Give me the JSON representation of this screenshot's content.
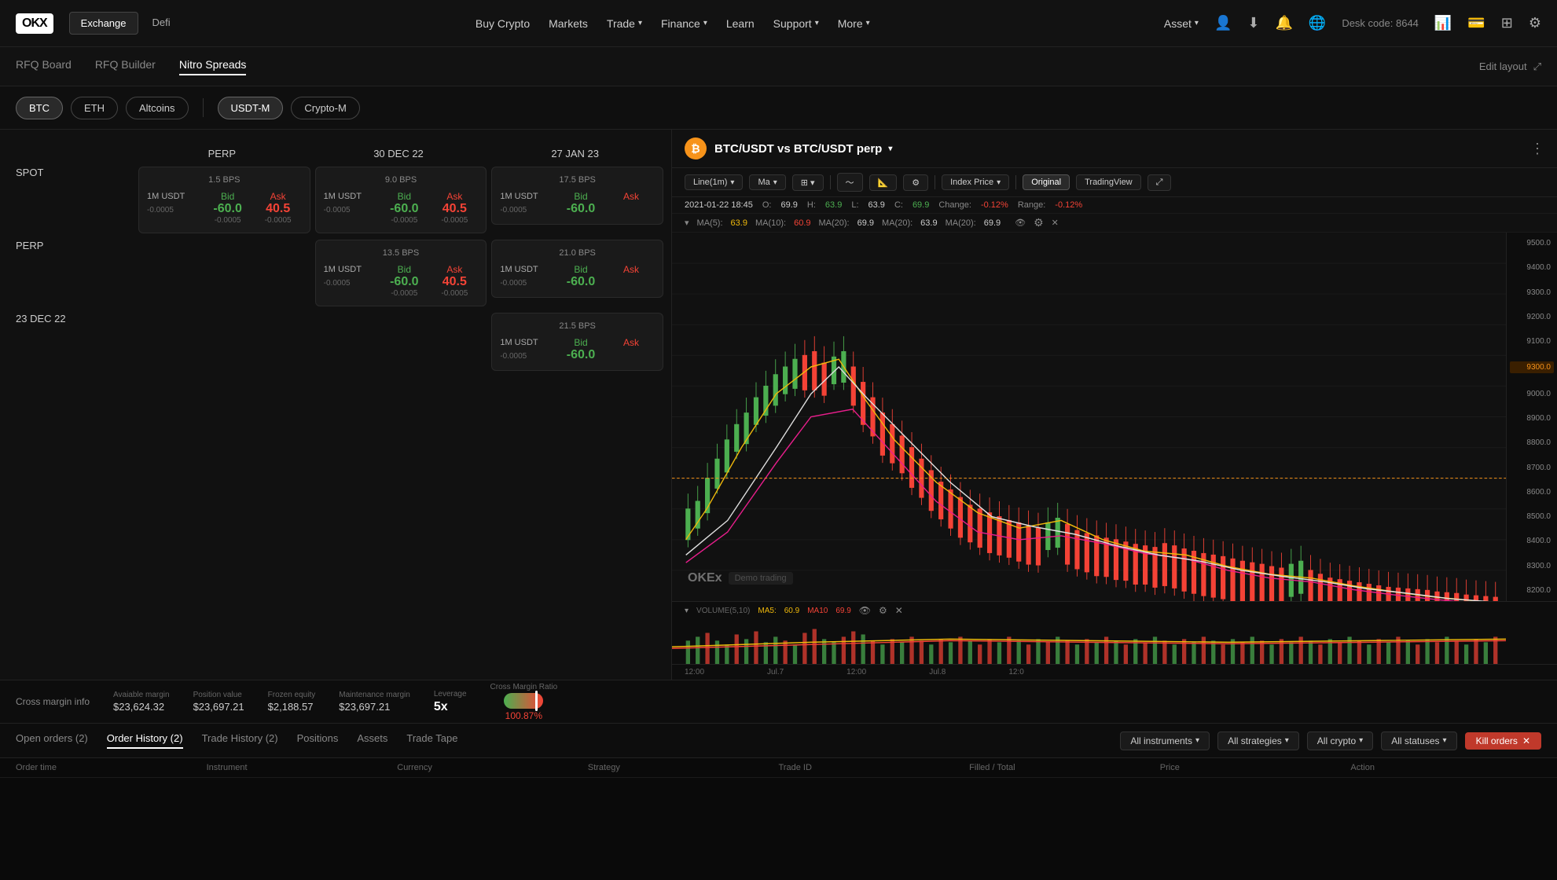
{
  "nav": {
    "logo": "OKX",
    "tabs": [
      {
        "id": "exchange",
        "label": "Exchange",
        "active": true
      },
      {
        "id": "defi",
        "label": "Defi",
        "active": false
      }
    ],
    "links": [
      {
        "id": "buy-crypto",
        "label": "Buy Crypto"
      },
      {
        "id": "markets",
        "label": "Markets"
      },
      {
        "id": "trade",
        "label": "Trade",
        "hasDropdown": true
      },
      {
        "id": "finance",
        "label": "Finance",
        "hasDropdown": true
      },
      {
        "id": "learn",
        "label": "Learn"
      },
      {
        "id": "support",
        "label": "Support",
        "hasDropdown": true
      },
      {
        "id": "more",
        "label": "More",
        "hasDropdown": true
      }
    ],
    "asset_label": "Asset",
    "desk_code_label": "Desk code:",
    "desk_code_value": "8644"
  },
  "sub_nav": {
    "items": [
      {
        "id": "rfq-board",
        "label": "RFQ Board",
        "active": false
      },
      {
        "id": "rfq-builder",
        "label": "RFQ Builder",
        "active": false
      },
      {
        "id": "nitro-spreads",
        "label": "Nitro Spreads",
        "active": true
      }
    ],
    "edit_layout": "Edit layout"
  },
  "filters": {
    "left": [
      {
        "id": "btc",
        "label": "BTC",
        "active": true
      },
      {
        "id": "eth",
        "label": "ETH",
        "active": false
      },
      {
        "id": "altcoins",
        "label": "Altcoins",
        "active": false
      }
    ],
    "right": [
      {
        "id": "usdt-m",
        "label": "USDT-M",
        "active": true
      },
      {
        "id": "crypto-m",
        "label": "Crypto-M",
        "active": false
      }
    ]
  },
  "grid": {
    "col_headers": [
      "PERP",
      "30 DEC 22",
      "27 JAN 23"
    ],
    "row_labels": [
      "SPOT",
      "PERP",
      "23 DEC 22"
    ],
    "cells": {
      "spot_perp": {
        "bps": "1.5 BPS",
        "unit": "1M USDT",
        "bid_label": "Bid",
        "ask_label": "Ask",
        "bid_val": "-60.0",
        "ask_val": "40.5",
        "bid_sub": "-0.0005",
        "ask_sub": "-0.0005"
      },
      "spot_dec30": {
        "bps": "9.0 BPS",
        "unit": "1M USDT",
        "bid_label": "Bid",
        "ask_label": "Ask",
        "bid_val": "-60.0",
        "ask_val": "40.5",
        "bid_sub": "-0.0005",
        "ask_sub": "-0.0005"
      },
      "spot_jan27": {
        "bps": "17.5 BPS",
        "unit": "1M USDT",
        "bid_label": "Bid",
        "ask_label": "Ask",
        "bid_val": "-60.0",
        "bid_sub": "-0.0005"
      },
      "perp_dec30": {
        "bps": "13.5 BPS",
        "unit": "1M USDT",
        "bid_label": "Bid",
        "ask_label": "Ask",
        "bid_val": "-60.0",
        "ask_val": "40.5",
        "bid_sub": "-0.0005",
        "ask_sub": "-0.0005"
      },
      "perp_jan27": {
        "bps": "21.0 BPS",
        "unit": "1M USDT",
        "bid_label": "Bid",
        "ask_label": "Ask",
        "bid_val": "-60.0",
        "bid_sub": "-0.0005"
      },
      "dec23_jan27": {
        "bps": "21.5 BPS",
        "unit": "1M USDT",
        "bid_label": "Bid",
        "ask_label": "Ask",
        "bid_val": "-60.0",
        "bid_sub": "-0.0005"
      }
    }
  },
  "chart": {
    "pair": "BTC/USDT vs BTC/USDT perp",
    "btc_icon": "₿",
    "timeframe": "Line(1m)",
    "indicator": "Ma",
    "original_label": "Original",
    "tradingview_label": "TradingView",
    "index_price": "Index Price",
    "info": {
      "date": "2021-01-22 18:45",
      "open_label": "O:",
      "open_val": "69.9",
      "high_label": "H:",
      "high_val": "63.9",
      "high_color": "green",
      "low_label": "L:",
      "low_val": "63.9",
      "close_label": "C:",
      "close_val": "69.9",
      "close_color": "green",
      "change_label": "Change:",
      "change_val": "-0.12%",
      "change_color": "red",
      "range_label": "Range:",
      "range_val": "-0.12%",
      "range_color": "red"
    },
    "ma": {
      "ma5_label": "MA(5):",
      "ma5_val": "63.9",
      "ma10_label": "MA(10):",
      "ma10_val": "60.9",
      "ma10_color": "red",
      "ma20a_label": "MA(20):",
      "ma20a_val": "69.9",
      "ma20b_label": "MA(20):",
      "ma20b_val": "63.9",
      "ma20c_label": "MA(20):",
      "ma20c_val": "69.9"
    },
    "prices": [
      9500,
      9400,
      9300,
      9200,
      9100,
      9000,
      8900,
      8800,
      8700,
      8600,
      8500,
      8400,
      8300,
      8200
    ],
    "current_price": "9300.0",
    "time_labels": [
      "12:00",
      "Jul.7",
      "12:00",
      "Jul.8",
      "12:0"
    ],
    "volume": {
      "label": "VOLUME(5,10)",
      "ma5_label": "MA5:",
      "ma5_val": "60.9",
      "ma10_label": "MA10",
      "ma10_val": "69.9"
    },
    "watermark": "OKEx",
    "demo_label": "Demo trading"
  },
  "bottom_margin": {
    "label": "Cross margin info",
    "available_label": "Avaiable margin",
    "available_val": "$23,624.32",
    "position_label": "Position value",
    "position_val": "$23,697.21",
    "frozen_label": "Frozen equity",
    "frozen_val": "$2,188.57",
    "maintenance_label": "Maintenance margin",
    "maintenance_val": "$23,697.21",
    "leverage_label": "Leverage",
    "leverage_val": "5x",
    "ratio_label": "Cross Margin Ratio",
    "ratio_val": "100.87%"
  },
  "tabs": {
    "items": [
      {
        "id": "open-orders",
        "label": "Open orders (2)",
        "active": false
      },
      {
        "id": "order-history",
        "label": "Order History (2)",
        "active": true
      },
      {
        "id": "trade-history",
        "label": "Trade History (2)",
        "active": false
      },
      {
        "id": "positions",
        "label": "Positions",
        "active": false
      },
      {
        "id": "assets",
        "label": "Assets",
        "active": false
      },
      {
        "id": "trade-tape",
        "label": "Trade Tape",
        "active": false
      }
    ],
    "filters": [
      {
        "id": "all-instruments",
        "label": "All instruments"
      },
      {
        "id": "all-strategies",
        "label": "All strategies"
      },
      {
        "id": "all-crypto",
        "label": "All crypto"
      },
      {
        "id": "all-statuses",
        "label": "All statuses"
      }
    ],
    "kill_orders": "Kill orders"
  },
  "table_header": {
    "cols": [
      "Order time",
      "Instrument",
      "Currency",
      "Strategy",
      "Trade ID",
      "Filled / Total",
      "Price",
      "Action"
    ]
  }
}
